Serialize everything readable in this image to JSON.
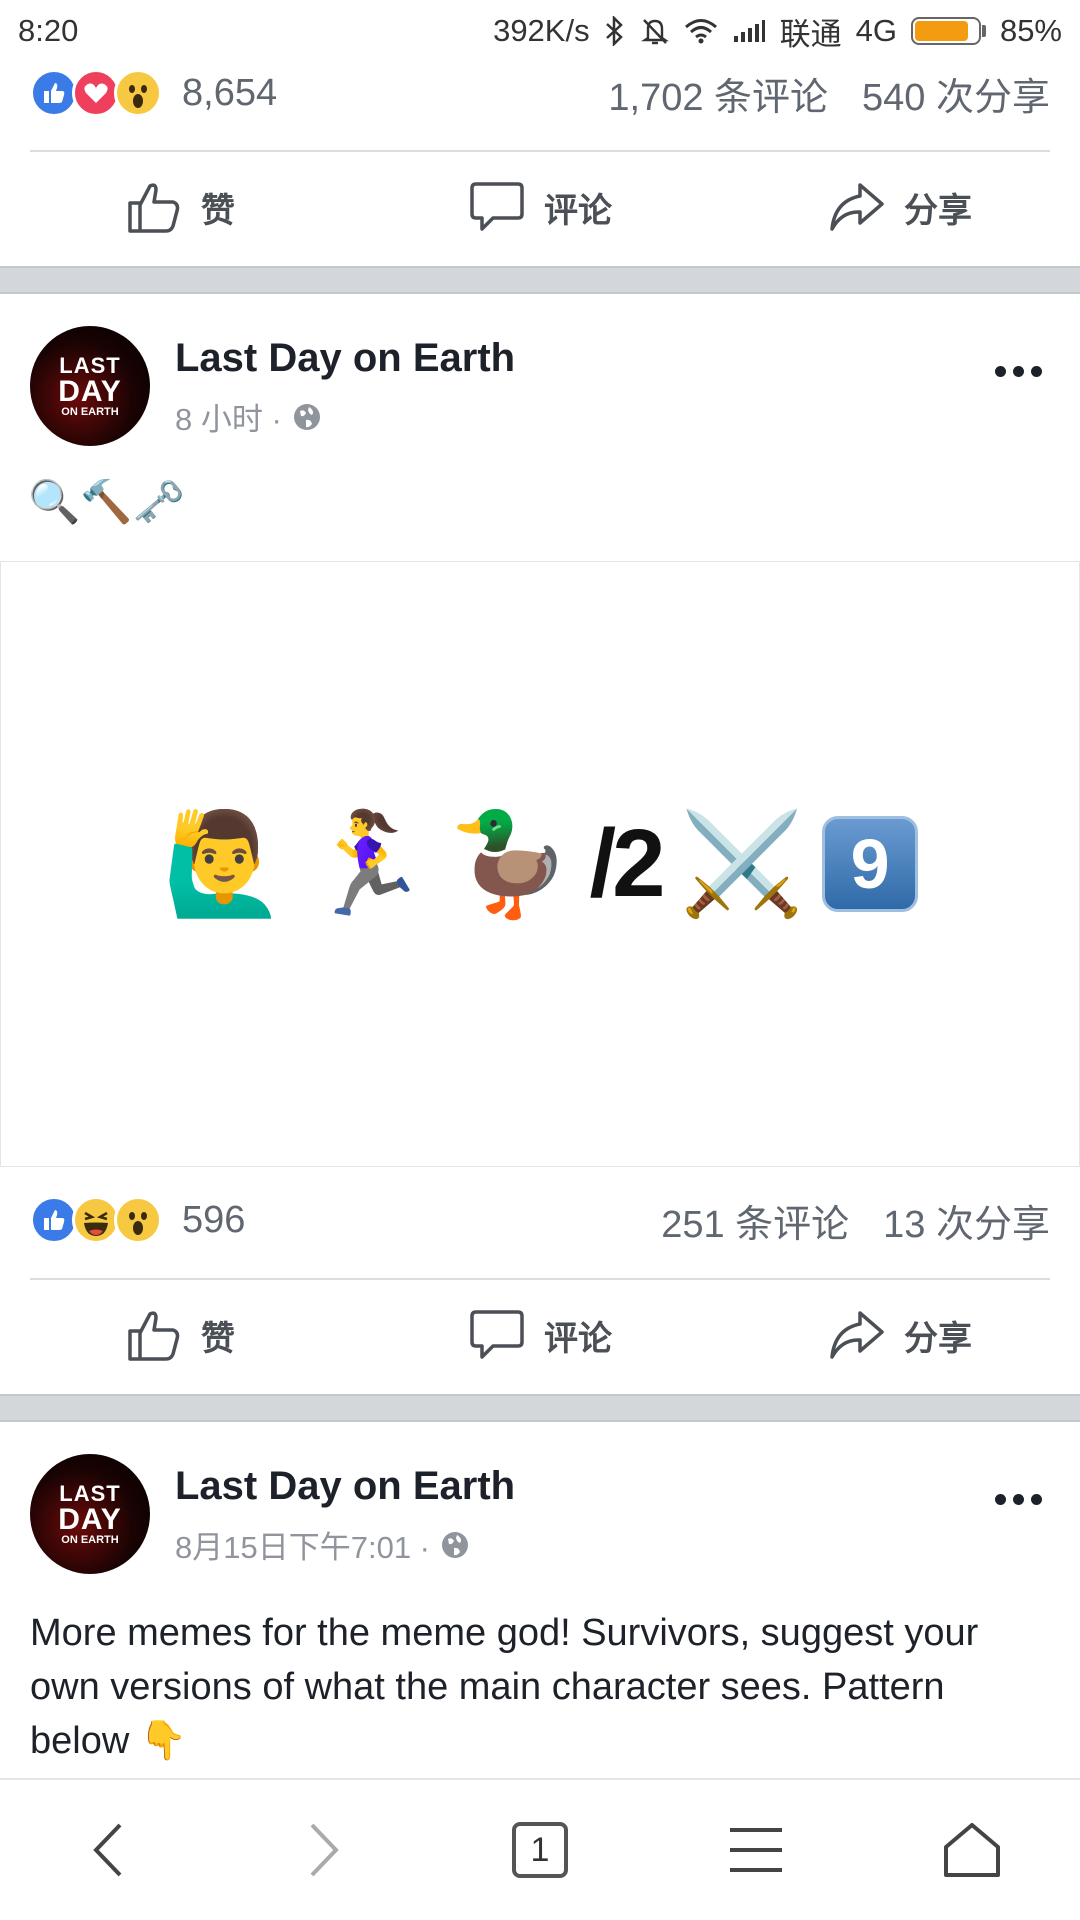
{
  "status_bar": {
    "time": "8:20",
    "net_speed": "392K/s",
    "carrier": "联通",
    "network": "4G",
    "battery": "85%",
    "battery_level": 0.85
  },
  "post1_footer": {
    "reaction_count": "8,654",
    "comments": "1,702 条评论",
    "shares": "540 次分享",
    "reactions": [
      "like-icon",
      "love-icon",
      "wow-icon"
    ]
  },
  "actions": {
    "like": "赞",
    "comment": "评论",
    "share": "分享"
  },
  "post2": {
    "page_name": "Last Day on Earth",
    "time": "8 小时 ·",
    "emoji_line": "🔍🔨🗝️",
    "image_emojis": [
      "🙋‍♂️",
      "🏃‍♀️",
      "🦆"
    ],
    "image_text": "/2",
    "image_swords": "⚔️",
    "image_number": "9",
    "reaction_count": "596",
    "comments": "251 条评论",
    "shares": "13 次分享",
    "reactions": [
      "like-icon",
      "haha-icon",
      "wow-icon"
    ]
  },
  "post3": {
    "page_name": "Last Day on Earth",
    "time": "8月15日下午7:01 ·",
    "text": "More memes for the meme god! Survivors, suggest your own versions of what the main character sees. Pattern below 👇"
  },
  "avatar_logo": {
    "line1": "LAST",
    "line2": "DAY",
    "line3": "ON EARTH"
  },
  "bottom_nav": {
    "tab_count": "1"
  }
}
